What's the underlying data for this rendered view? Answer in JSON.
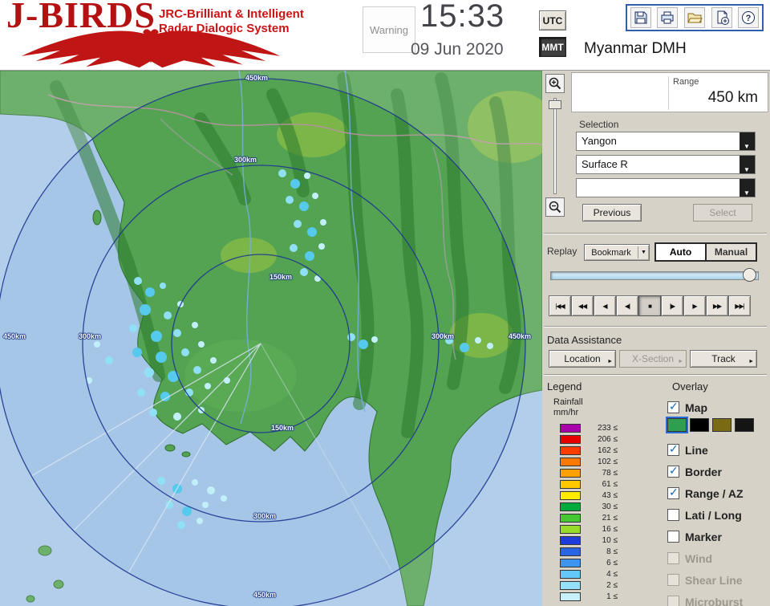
{
  "header": {
    "logo_title": "J-BIRDS",
    "logo_subtitle_line1": "JRC-Brilliant & Intelligent",
    "logo_subtitle_line2": "Radar Dialogic System",
    "warning_label": "Warning",
    "time": "15:33",
    "date": "09 Jun 2020",
    "timezone_buttons": {
      "utc": "UTC",
      "mmt": "MMT",
      "selected": "MMT"
    },
    "station_name": "Myanmar DMH",
    "toolbar_icons": [
      "save-icon",
      "print-icon",
      "folder-icon",
      "export-icon",
      "help-icon"
    ]
  },
  "range_panel": {
    "label": "Range",
    "value": "450 km"
  },
  "selection": {
    "label": "Selection",
    "site_dropdown": "Yangon",
    "product_dropdown": "Surface R",
    "extra_dropdown": "",
    "previous_button": "Previous",
    "select_button": "Select"
  },
  "replay": {
    "label": "Replay",
    "bookmark_button": "Bookmark",
    "modes": [
      {
        "label": "Auto",
        "selected": true
      },
      {
        "label": "Manual",
        "selected": false
      }
    ],
    "playback_buttons": [
      {
        "glyph": "|◀◀",
        "name": "skip-to-start",
        "pressed": false
      },
      {
        "glyph": "◀◀",
        "name": "fast-rewind",
        "pressed": false
      },
      {
        "glyph": "◀",
        "name": "play-reverse",
        "pressed": false
      },
      {
        "glyph": "◀|",
        "name": "step-back",
        "pressed": false
      },
      {
        "glyph": "■",
        "name": "stop",
        "pressed": true
      },
      {
        "glyph": "|▶",
        "name": "step-forward",
        "pressed": false
      },
      {
        "glyph": "▶",
        "name": "play",
        "pressed": false
      },
      {
        "glyph": "▶▶",
        "name": "fast-forward",
        "pressed": false
      },
      {
        "glyph": "▶▶|",
        "name": "skip-to-end",
        "pressed": false
      }
    ]
  },
  "data_assistance": {
    "label": "Data Assistance",
    "buttons": [
      {
        "label": "Location",
        "enabled": true
      },
      {
        "label": "X-Section",
        "enabled": false
      },
      {
        "label": "Track",
        "enabled": true
      }
    ]
  },
  "legend": {
    "label": "Legend",
    "unit_line1": "Rainfall",
    "unit_line2": "mm/hr",
    "scale": [
      {
        "value": "233 ≤",
        "color": "#aa00aa"
      },
      {
        "value": "206 ≤",
        "color": "#e60000"
      },
      {
        "value": "162 ≤",
        "color": "#ff3c00"
      },
      {
        "value": "102 ≤",
        "color": "#ff7800"
      },
      {
        "value": "78 ≤",
        "color": "#ffa000"
      },
      {
        "value": "61 ≤",
        "color": "#ffc800"
      },
      {
        "value": "43 ≤",
        "color": "#ffec00"
      },
      {
        "value": "30 ≤",
        "color": "#00aa3c"
      },
      {
        "value": "21 ≤",
        "color": "#46c832"
      },
      {
        "value": "16 ≤",
        "color": "#96dc28"
      },
      {
        "value": "10 ≤",
        "color": "#1e3cdc"
      },
      {
        "value": "8 ≤",
        "color": "#2864e6"
      },
      {
        "value": "6 ≤",
        "color": "#3c96f0"
      },
      {
        "value": "4 ≤",
        "color": "#64c8fa"
      },
      {
        "value": "2 ≤",
        "color": "#96e1fa"
      },
      {
        "value": "1 ≤",
        "color": "#c8f0fa"
      }
    ]
  },
  "overlay": {
    "label": "Overlay",
    "map_palette": [
      "#2f9e4f",
      "#000000",
      "#7a6a14",
      "#141414"
    ],
    "items": [
      {
        "label": "Map",
        "checked": true,
        "enabled": true
      },
      {
        "label": "Line",
        "checked": true,
        "enabled": true
      },
      {
        "label": "Border",
        "checked": true,
        "enabled": true
      },
      {
        "label": "Range / AZ",
        "checked": true,
        "enabled": true
      },
      {
        "label": "Lati / Long",
        "checked": false,
        "enabled": true
      },
      {
        "label": "Marker",
        "checked": false,
        "enabled": true
      },
      {
        "label": "Wind",
        "checked": false,
        "enabled": false
      },
      {
        "label": "Shear Line",
        "checked": false,
        "enabled": false
      },
      {
        "label": "Microburst",
        "checked": false,
        "enabled": false
      }
    ]
  },
  "map": {
    "ring_labels": [
      "450km",
      "300km",
      "150km",
      "150km",
      "300km",
      "450km",
      "450km",
      "300km",
      "300km",
      "450km"
    ]
  }
}
